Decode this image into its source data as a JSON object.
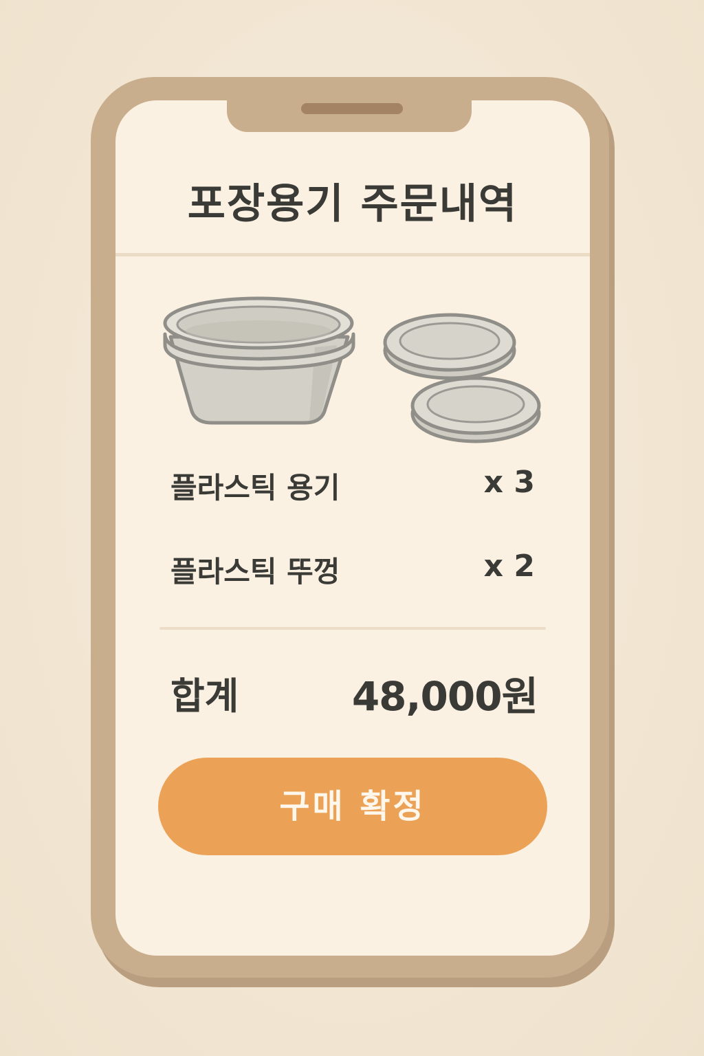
{
  "header": {
    "title": "포장용기 주문내역"
  },
  "order": {
    "items": [
      {
        "icon": "plastic-container-icon",
        "name": "플라스틱 용기",
        "quantity": "x 3"
      },
      {
        "icon": "plastic-lid-icon",
        "name": "플라스틱 뚜껑",
        "quantity": "x 2"
      }
    ],
    "total_label": "합계",
    "total_value": "48,000원"
  },
  "actions": {
    "confirm_label": "구매 확정"
  },
  "colors": {
    "background": "#f1e6d4",
    "phone_frame": "#c8ae8d",
    "screen": "#fbf1e2",
    "text": "#3a3a36",
    "accent_button": "#eca256",
    "button_text": "#fff7ec"
  }
}
